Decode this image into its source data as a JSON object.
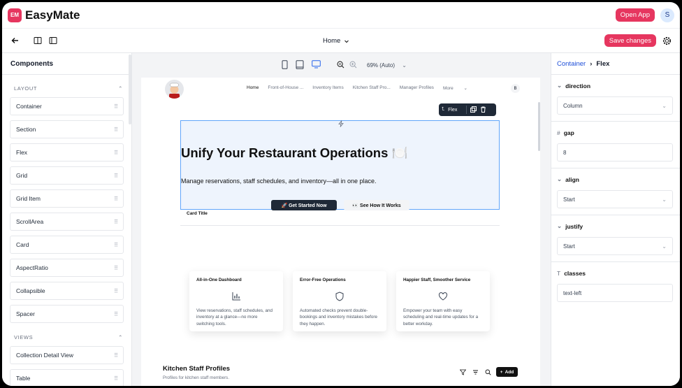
{
  "app": {
    "brand": "EasyMate",
    "logo_text": "EM",
    "open_app_label": "Open App",
    "avatar_initial": "S"
  },
  "toolbar": {
    "page_name": "Home",
    "save_label": "Save changes"
  },
  "components_panel": {
    "title": "Components",
    "sections": [
      {
        "label": "LAYOUT",
        "items": [
          "Container",
          "Section",
          "Flex",
          "Grid",
          "Grid Item",
          "ScrollArea",
          "Card",
          "AspectRatio",
          "Collapsible",
          "Spacer"
        ]
      },
      {
        "label": "VIEWS",
        "items": [
          "Collection Detail View",
          "Table"
        ]
      }
    ]
  },
  "canvas": {
    "zoom": "69% (Auto)"
  },
  "preview": {
    "nav": [
      "Home",
      "Front-of-House ...",
      "Inventory Items",
      "Kitchen Staff Pro...",
      "Manager Profiles",
      "More"
    ],
    "user_initial": "B",
    "float_toolbar_label": "Flex",
    "hero": {
      "title": "Unify Your Restaurant Operations 🍽️",
      "subtitle": "Manage reservations, staff schedules, and inventory—all in one place.",
      "primary_btn": "🚀 Get Started Now",
      "secondary_btn": "👀 See How It Works"
    },
    "card_title": "Card Title",
    "features": [
      {
        "title": "All-in-One Dashboard",
        "icon": "bar-chart-icon",
        "desc": "View reservations, staff schedules, and inventory at a glance—no more switching tools."
      },
      {
        "title": "Error-Free Operations",
        "icon": "shield-icon",
        "desc": "Automated checks prevent double-bookings and inventory mistakes before they happen."
      },
      {
        "title": "Happier Staff, Smoother Service",
        "icon": "heart-icon",
        "desc": "Empower your team with easy scheduling and real-time updates for a better workday."
      }
    ],
    "kitchen": {
      "title": "Kitchen Staff Profiles",
      "subtitle": "Profiles for kitchen staff members.",
      "add_label": "Add"
    }
  },
  "properties": {
    "breadcrumb_parent": "Container",
    "breadcrumb_current": "Flex",
    "direction": {
      "label": "direction",
      "value": "Column"
    },
    "gap": {
      "label": "gap",
      "value": "8"
    },
    "align": {
      "label": "align",
      "value": "Start"
    },
    "justify": {
      "label": "justify",
      "value": "Start"
    },
    "classes": {
      "label": "classes",
      "value": "text-left"
    }
  },
  "colors": {
    "accent": "#e6365f",
    "selection": "#60a5fa",
    "link": "#1d4ed8"
  }
}
